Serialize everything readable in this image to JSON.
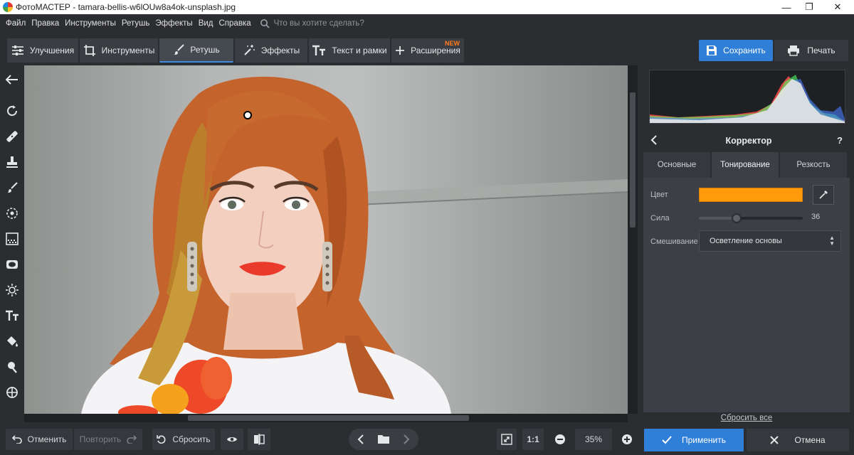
{
  "window": {
    "title": "ФотоМАСТЕР - tamara-bellis-w6lOUw8a4ok-unsplash.jpg",
    "controls": [
      "—",
      "❐",
      "✕"
    ]
  },
  "menu": {
    "items": [
      "Файл",
      "Правка",
      "Инструменты",
      "Ретушь",
      "Эффекты",
      "Вид",
      "Справка"
    ],
    "search_placeholder": "Что вы хотите сделать?"
  },
  "tabs": [
    {
      "label": "Улучшения",
      "icon": "sliders-icon"
    },
    {
      "label": "Инструменты",
      "icon": "crop-icon"
    },
    {
      "label": "Ретушь",
      "icon": "brush-icon",
      "active": true
    },
    {
      "label": "Эффекты",
      "icon": "magic-wand-icon"
    },
    {
      "label": "Текст и рамки",
      "icon": "text-icon"
    },
    {
      "label": "Расширения",
      "icon": "plus-icon",
      "badge": "NEW"
    }
  ],
  "actions": {
    "save": "Сохранить",
    "print": "Печать"
  },
  "tools": [
    "back-arrow-icon",
    "rotate-icon",
    "healing-patch-icon",
    "stamp-icon",
    "brush-icon",
    "radial-icon",
    "gradient-icon",
    "vignette-icon",
    "light-icon",
    "text-tool-icon",
    "fill-bucket-icon",
    "dodge-icon",
    "crosshair-icon"
  ],
  "histogram": {
    "colors": [
      "#ff4a4a",
      "#4aff66",
      "#4a7dff",
      "#e6e6e6"
    ]
  },
  "corrector": {
    "title": "Корректор",
    "help": "?",
    "tabs": [
      "Основные",
      "Тонирование",
      "Резкость"
    ],
    "active_tab": 1,
    "color_label": "Цвет",
    "color_value": "#ff9a0a",
    "strength_label": "Сила",
    "strength": 36,
    "strength_max": 100,
    "blend_label": "Смешивание",
    "blend_value": "Осветление основы",
    "reset_all": "Сбросить все"
  },
  "bottom": {
    "undo": "Отменить",
    "redo": "Повторить",
    "reset": "Сбросить",
    "zoom_fit": "1:1",
    "zoom_value": "35%",
    "apply": "Применить",
    "cancel": "Отмена"
  }
}
